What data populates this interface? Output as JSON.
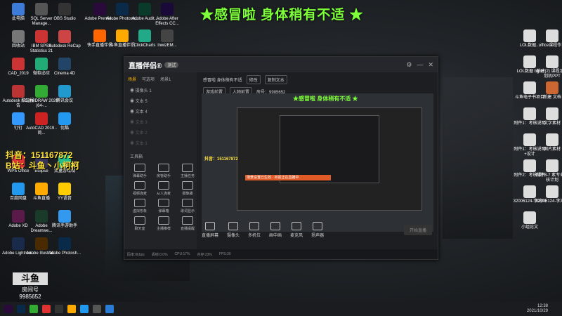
{
  "banner": "★感冒啦 身体稍有不适 ★",
  "stream_text": {
    "line1": "抖音：151167872",
    "line2": "B站：斗鱼丶小柯柯"
  },
  "logo": {
    "label": "斗鱼",
    "sub": "房间号",
    "num": "9985652"
  },
  "desktop_left": [
    {
      "label": "此电脑",
      "color": "#3d7bd9"
    },
    {
      "label": "SQL Server Manage...",
      "color": "#555"
    },
    {
      "label": "OBS Studio",
      "color": "#333"
    },
    {
      "label": "回收站",
      "color": "#777"
    },
    {
      "label": "IBM SPSS Statistics 21",
      "color": "#c33"
    },
    {
      "label": "Autodesk ReCap",
      "color": "#c44"
    },
    {
      "label": "CAD_2019",
      "color": "#c33"
    },
    {
      "label": "微软必应",
      "color": "#2a7"
    },
    {
      "label": "Cinema 4D",
      "color": "#246"
    },
    {
      "label": "Autodesk 酷记报告",
      "color": "#b33"
    },
    {
      "label": "CorelDRAW 2020 (64-...",
      "color": "#3a3"
    },
    {
      "label": "腾讯会议",
      "color": "#29c"
    },
    {
      "label": "钉钉",
      "color": "#39f"
    },
    {
      "label": "AutoCAD 2019 - 简...",
      "color": "#c22"
    },
    {
      "label": "优酷",
      "color": "#29e"
    },
    {
      "label": "WPS Office",
      "color": "#d33"
    },
    {
      "label": "Eclipse",
      "color": "#335"
    },
    {
      "label": "流量游戏魂",
      "color": "#2b8"
    },
    {
      "label": "百度网盘",
      "color": "#29e"
    },
    {
      "label": "斗鱼直播",
      "color": "#fa0"
    },
    {
      "label": "YY语音",
      "color": "#fc0"
    },
    {
      "label": "Adobe XD",
      "color": "#5a1a4a"
    },
    {
      "label": "Adobe Dreamwe...",
      "color": "#1a3a2a"
    },
    {
      "label": "腾讯手游助手",
      "color": "#39e"
    },
    {
      "label": "Adobe Lightroo...",
      "color": "#1a2a4a"
    },
    {
      "label": "Adobe Illustrat...",
      "color": "#4a2a00"
    },
    {
      "label": "Adobe Photosh...",
      "color": "#0a2a4a"
    }
  ],
  "desktop_top": [
    {
      "label": "Adobe Premie...",
      "color": "#2a0a3a"
    },
    {
      "label": "Adobe Photosh...",
      "color": "#0a2a4a"
    },
    {
      "label": "Adobe Audit...",
      "color": "#0a3a2a"
    },
    {
      "label": "Adobe After Effects CC...",
      "color": "#1a0a3a"
    },
    {
      "label": "快手直播伴侣",
      "color": "#f60"
    },
    {
      "label": "斗鱼直播伴侣",
      "color": "#fa0"
    },
    {
      "label": "ClickCharts",
      "color": "#2a8"
    },
    {
      "label": "lnwizEM...",
      "color": "#444"
    }
  ],
  "desktop_right": [
    {
      "label": "LOL数据...",
      "color": "#ddd"
    },
    {
      "label": "office课程作业",
      "color": "#ddd"
    },
    {
      "label": "LOL数据 bgm",
      "color": "#ddd"
    },
    {
      "label": "新建(2) 课程示规划机PPT",
      "color": "#ddd"
    },
    {
      "label": "斗鱼电子书项目",
      "color": "#ddd"
    },
    {
      "label": "新建 文档",
      "color": "#c63"
    },
    {
      "label": "附件1：考核说明",
      "color": "#ddd"
    },
    {
      "label": "文字素材",
      "color": "#ddd"
    },
    {
      "label": "附件1：考核说明+设计",
      "color": "#ddd"
    },
    {
      "label": "图片素材",
      "color": "#ddd"
    },
    {
      "label": "附件2：考核课件",
      "color": "#ddd"
    },
    {
      "label": "附件3-7 素专业考核计划",
      "color": "#ddd"
    },
    {
      "label": "32006124-李鸿川",
      "color": "#ddd"
    },
    {
      "label": "32006124-李鸿川",
      "color": "#ddd"
    },
    {
      "label": "小组论文",
      "color": "#ddd"
    }
  ],
  "window": {
    "brand": "直播伴侣®",
    "badge": "测试",
    "tabs": [
      "场景",
      "可选项",
      "场景1"
    ],
    "scenes": [
      {
        "name": "摄像头 1",
        "dim": false
      },
      {
        "name": "文本 5",
        "dim": false
      },
      {
        "name": "文本 4",
        "dim": false
      },
      {
        "name": "文本 3",
        "dim": true
      },
      {
        "name": "文本 2",
        "dim": true
      },
      {
        "name": "文本 1",
        "dim": true
      }
    ],
    "tools_title": "工具箱",
    "tools": [
      "弹幕助手",
      "房管助手",
      "主播任务",
      "视频连麦",
      "从人连麦",
      "摄像播",
      "虚拟形象",
      "弹幕箱",
      "歌词显示",
      "聊天室",
      "主播推荐",
      "直播提醒"
    ],
    "top": {
      "title": "感冒啦 身体稍有不适",
      "btn1": "修改",
      "btn2": "复制文本",
      "tag1": "游戏前置",
      "tag2": "人物前置",
      "room": "房号：9985652"
    },
    "preview_banner": "★感冒啦 身体稍有不适 ★",
    "preview_text": "抖音：151167872",
    "redbar": "场景设置已生效 · 目前正在直播中",
    "bottom": [
      "直播屏幕",
      "摄像头",
      "多机位",
      "画中画",
      "麦克风",
      "扬声器"
    ],
    "start": "开始直播",
    "status": [
      "码率:0kbps",
      "丢帧:0.0%",
      "CPU:17%",
      "内存:23%",
      "FPS:30"
    ]
  },
  "clock": {
    "time": "12:38",
    "date": "2021/10/29"
  }
}
